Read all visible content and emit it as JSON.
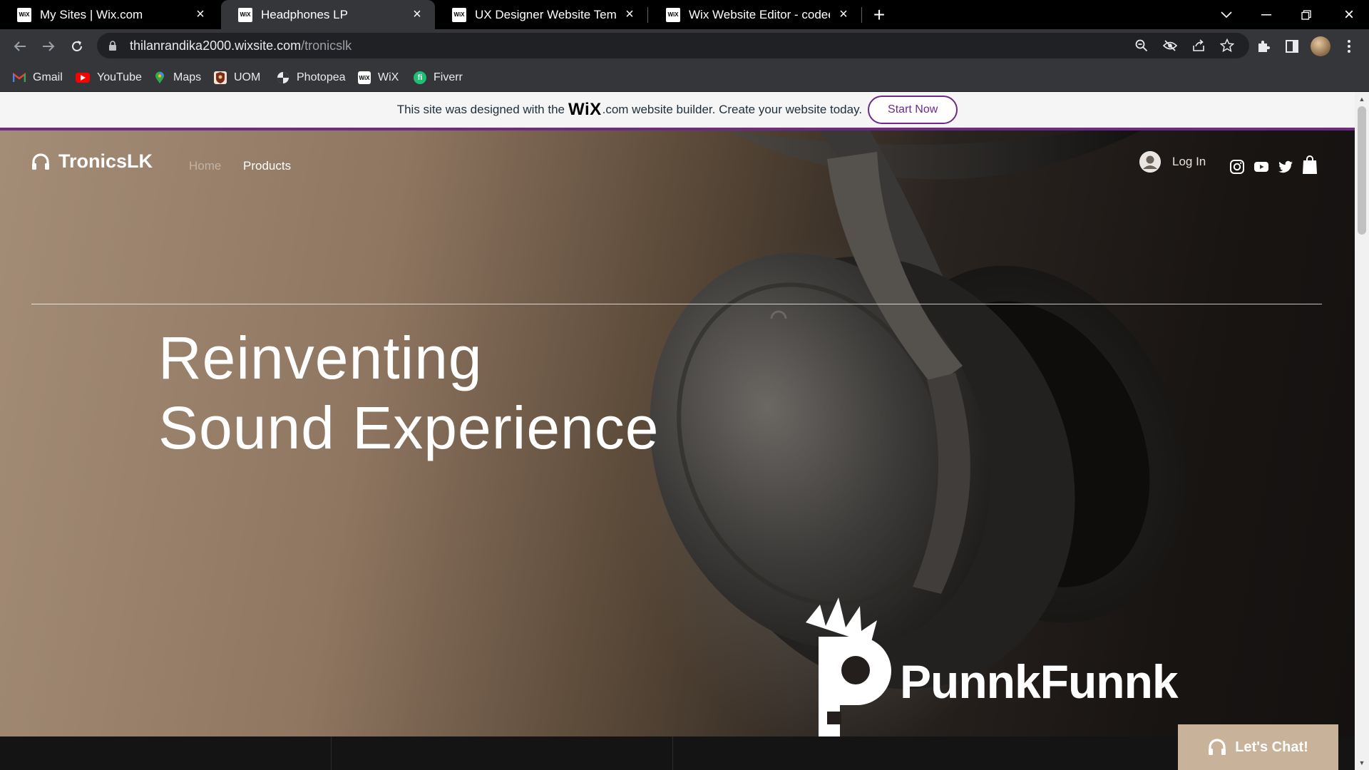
{
  "browser": {
    "tabs": [
      {
        "favicon": "WiX",
        "title": "My Sites | Wix.com",
        "active": false
      },
      {
        "favicon": "WiX",
        "title": "Headphones LP",
        "active": true
      },
      {
        "favicon": "WiX",
        "title": "UX Designer Website Template |  ",
        "active": false
      },
      {
        "favicon": "WiX",
        "title": "Wix Website Editor - codeerror",
        "active": false
      }
    ],
    "url": {
      "host": "thilanrandika2000.wixsite.com",
      "path": "/tronicslk"
    },
    "bookmarks": [
      {
        "label": "Gmail",
        "icon": "gmail-icon"
      },
      {
        "label": "YouTube",
        "icon": "youtube-icon"
      },
      {
        "label": "Maps",
        "icon": "maps-icon"
      },
      {
        "label": "UOM",
        "icon": "uom-icon"
      },
      {
        "label": "Photopea",
        "icon": "photopea-icon"
      },
      {
        "label": "WiX",
        "icon": "wix-icon"
      },
      {
        "label": "Fiverr",
        "icon": "fiverr-icon"
      }
    ]
  },
  "wix_banner": {
    "before": "This site was designed with the",
    "logo": "WiX",
    "after": ".com website builder. Create your website today.",
    "cta": "Start Now"
  },
  "site": {
    "brand": "TronicsLK",
    "nav": [
      {
        "label": "Home",
        "active": true
      },
      {
        "label": "Products",
        "active": false
      }
    ],
    "login": "Log In",
    "headline": [
      "Reinventing",
      "Sound Experience"
    ],
    "partner_logo": "PunnkFunnk",
    "chat_label": "Let's Chat!"
  },
  "colors": {
    "wix_purple": "#6e2a87",
    "chat_bg": "#c8b29a",
    "hero_warm": "#a48d77",
    "hero_dark": "#141110"
  }
}
